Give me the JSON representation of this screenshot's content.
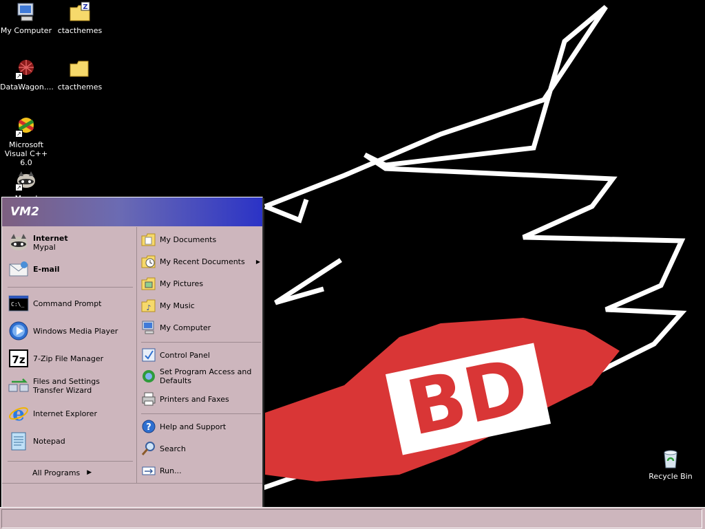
{
  "desktop": {
    "icons": [
      {
        "label": "My Computer",
        "icon": "computer-icon"
      },
      {
        "label": "ctacthemes",
        "icon": "zip-folder-icon"
      },
      {
        "label": "DataWagon....",
        "icon": "datawagon-icon"
      },
      {
        "label": "ctacthemes",
        "icon": "folder-icon"
      },
      {
        "label": "Microsoft Visual C++ 6.0",
        "icon": "visual-cpp-icon"
      },
      {
        "label": "Mypal",
        "icon": "raccoon-icon"
      },
      {
        "label": "Recycle Bin",
        "icon": "recycle-bin-icon"
      }
    ]
  },
  "wallpaper": {
    "text": "BD",
    "accent": "#d93636"
  },
  "start_menu": {
    "user": "VM2",
    "pinned": [
      {
        "title": "Internet",
        "subtitle": "Mypal",
        "icon": "raccoon-icon"
      },
      {
        "title": "E-mail",
        "icon": "mail-icon"
      }
    ],
    "recent": [
      {
        "label": "Command Prompt",
        "icon": "cmd-icon"
      },
      {
        "label": "Windows Media Player",
        "icon": "media-player-icon"
      },
      {
        "label": "7-Zip File Manager",
        "icon": "7zip-icon"
      },
      {
        "label": "Files and Settings Transfer Wizard",
        "icon": "transfer-wizard-icon"
      },
      {
        "label": "Internet Explorer",
        "icon": "ie-icon"
      },
      {
        "label": "Notepad",
        "icon": "notepad-icon"
      }
    ],
    "all_programs": "All Programs",
    "right_top": [
      {
        "label": "My Documents",
        "icon": "documents-folder-icon"
      },
      {
        "label": "My Recent Documents",
        "icon": "recent-documents-icon",
        "arrow": true
      },
      {
        "label": "My Pictures",
        "icon": "pictures-folder-icon"
      },
      {
        "label": "My Music",
        "icon": "music-folder-icon"
      },
      {
        "label": "My Computer",
        "icon": "computer-icon"
      }
    ],
    "right_middle": [
      {
        "label": "Control Panel",
        "icon": "control-panel-icon"
      },
      {
        "label": "Set Program Access and Defaults",
        "icon": "program-defaults-icon"
      },
      {
        "label": "Printers and Faxes",
        "icon": "printer-icon"
      }
    ],
    "right_bottom": [
      {
        "label": "Help and Support",
        "icon": "help-icon"
      },
      {
        "label": "Search",
        "icon": "search-icon"
      },
      {
        "label": "Run...",
        "icon": "run-icon"
      }
    ]
  },
  "colors": {
    "menu_bg": "#cdb6bd",
    "header_start": "#7d5f80",
    "header_end": "#2b33c6",
    "desktop": "#000000"
  }
}
